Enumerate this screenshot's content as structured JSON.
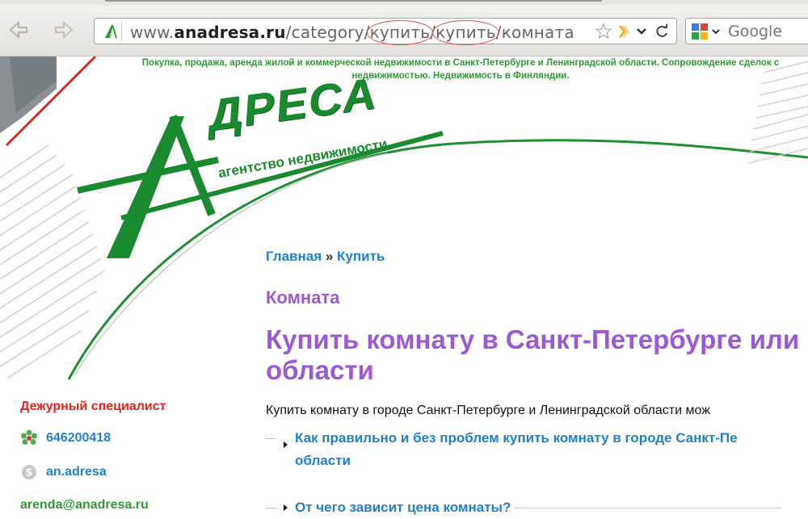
{
  "browser": {
    "url": {
      "prefix": "www.",
      "domain": "anadresa.ru",
      "path_1": "/category/",
      "segment_1": "купить",
      "slash_1": "/",
      "segment_2": "купить",
      "path_2": "/комната"
    },
    "search": {
      "placeholder": "Google"
    },
    "icons": [
      "back-arrow-icon",
      "forward-arrow-icon",
      "star-icon",
      "feed-icon",
      "chevron-down-icon",
      "reload-icon",
      "google-icon"
    ]
  },
  "header": {
    "tagline": "Покупка, продажа, аренда жилой и коммерческой недвижимости в Санкт-Петербурге и Ленинградской области. Сопровождение сделок с недвижимостью. Недвижимость в Финляндии.",
    "logo_title": "ДРЕСА",
    "logo_letter": "А",
    "logo_subtitle": "агентство недвижимости"
  },
  "breadcrumb": {
    "home": "Главная",
    "separator": " » ",
    "current": "Купить"
  },
  "main": {
    "section_title": "Комната",
    "heading_line1": "Купить комнату в Санкт-Петербурге или",
    "heading_line2": "области",
    "intro": "Купить комнату в городе Санкт-Петербурге и Ленинградской области мож"
  },
  "toc": [
    {
      "line1": "Как правильно и без проблем купить комнату в городе Санкт-Пе",
      "line2": "области"
    },
    {
      "line1": "От чего зависит цена комнаты?"
    }
  ],
  "sidebar": {
    "duty_title": "Дежурный специалист",
    "icq": "646200418",
    "skype": "an.adresa",
    "email": "arenda@anadresa.ru"
  },
  "colors": {
    "brand_green": "#1a8a2e",
    "link_blue": "#1f7fd1",
    "heading_purple": "#9b59d6",
    "alert_red": "#e8231f"
  }
}
